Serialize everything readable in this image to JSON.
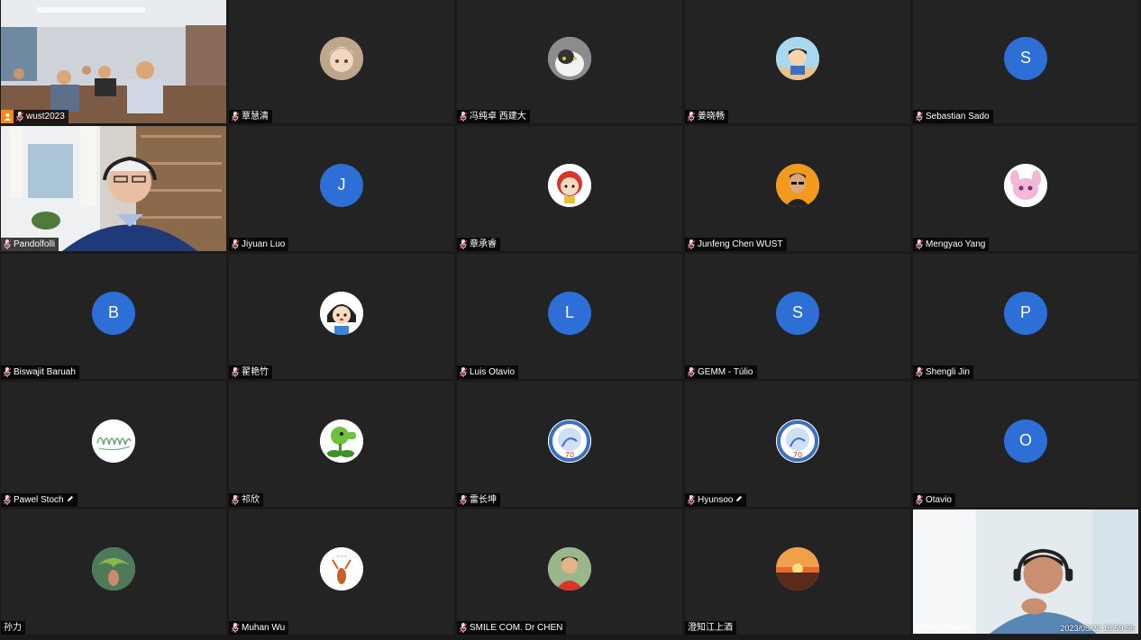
{
  "meeting": {
    "timestamp": "2023/05/22 18:59:56"
  },
  "colors": {
    "avatar_blue": "#2d6fd6",
    "active_speaker_border": "#35b24a",
    "tile_bg": "#232323"
  },
  "participants": [
    {
      "name": "wust2023",
      "kind": "video-room",
      "host": true
    },
    {
      "name": "覃慧清",
      "kind": "photo",
      "icon": "anime-character-avatar"
    },
    {
      "name": "冯纯卓 西建大",
      "kind": "photo",
      "icon": "cat-avatar"
    },
    {
      "name": "姜晓畅",
      "kind": "photo",
      "icon": "cartoon-boy-avatar"
    },
    {
      "name": "Sebastian Sado",
      "kind": "letter",
      "letter": "S"
    },
    {
      "name": "Pandolfolli",
      "kind": "video-speaker",
      "active": true
    },
    {
      "name": "Jiyuan Luo",
      "kind": "letter",
      "letter": "J"
    },
    {
      "name": "章承睿",
      "kind": "photo",
      "icon": "cartoon-girl-red-avatar"
    },
    {
      "name": "Junfeng Chen WUST",
      "kind": "photo",
      "icon": "man-portrait-avatar"
    },
    {
      "name": "Mengyao Yang",
      "kind": "photo",
      "icon": "pink-creature-avatar"
    },
    {
      "name": "Biswajit Baruah",
      "kind": "letter",
      "letter": "B"
    },
    {
      "name": "翟艳竹",
      "kind": "photo",
      "icon": "cartoon-girl-avatar"
    },
    {
      "name": "Luis Otavio",
      "kind": "letter",
      "letter": "L"
    },
    {
      "name": "GEMM - Túlio",
      "kind": "letter",
      "letter": "S"
    },
    {
      "name": "Shengli Jin",
      "kind": "letter",
      "letter": "P"
    },
    {
      "name": "Pawel Stoch",
      "kind": "photo",
      "icon": "signature-avatar",
      "editable": true
    },
    {
      "name": "祁欣",
      "kind": "photo",
      "icon": "peashooter-avatar"
    },
    {
      "name": "雷长坤",
      "kind": "photo",
      "icon": "anniversary-logo-avatar"
    },
    {
      "name": "Hyunsoo",
      "kind": "photo",
      "icon": "anniversary-logo-avatar",
      "editable": true
    },
    {
      "name": "Otavio",
      "kind": "letter",
      "letter": "O"
    },
    {
      "name": "孙力",
      "kind": "photo",
      "icon": "plant-hand-avatar",
      "nomic": true
    },
    {
      "name": "Muhan Wu",
      "kind": "photo",
      "icon": "deer-avatar"
    },
    {
      "name": "SMILE COM. Dr CHEN",
      "kind": "photo",
      "icon": "man-red-shirt-avatar"
    },
    {
      "name": "澄知江上酒",
      "kind": "photo",
      "icon": "sunset-avatar",
      "nomic": true
    },
    {
      "name": "Patrick Gehre",
      "kind": "video-person",
      "nomic": true
    }
  ]
}
